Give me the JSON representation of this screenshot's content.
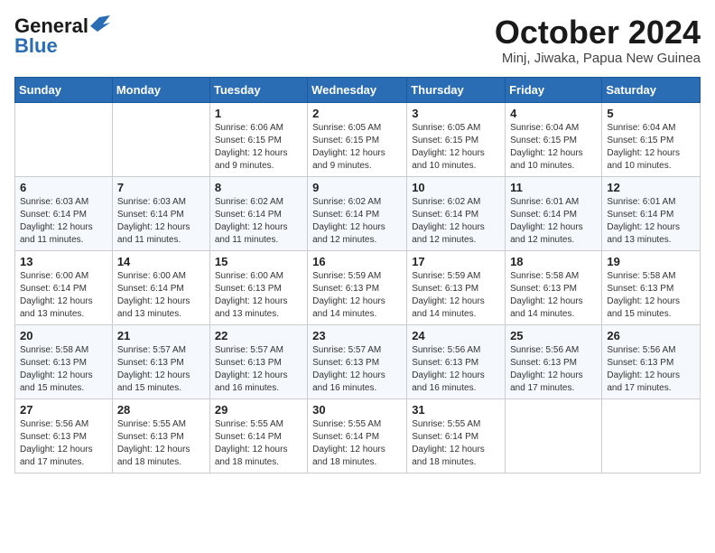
{
  "header": {
    "logo_general": "General",
    "logo_blue": "Blue",
    "month_title": "October 2024",
    "location": "Minj, Jiwaka, Papua New Guinea"
  },
  "days_of_week": [
    "Sunday",
    "Monday",
    "Tuesday",
    "Wednesday",
    "Thursday",
    "Friday",
    "Saturday"
  ],
  "weeks": [
    [
      {
        "day": "",
        "info": ""
      },
      {
        "day": "",
        "info": ""
      },
      {
        "day": "1",
        "info": "Sunrise: 6:06 AM\nSunset: 6:15 PM\nDaylight: 12 hours and 9 minutes."
      },
      {
        "day": "2",
        "info": "Sunrise: 6:05 AM\nSunset: 6:15 PM\nDaylight: 12 hours and 9 minutes."
      },
      {
        "day": "3",
        "info": "Sunrise: 6:05 AM\nSunset: 6:15 PM\nDaylight: 12 hours and 10 minutes."
      },
      {
        "day": "4",
        "info": "Sunrise: 6:04 AM\nSunset: 6:15 PM\nDaylight: 12 hours and 10 minutes."
      },
      {
        "day": "5",
        "info": "Sunrise: 6:04 AM\nSunset: 6:15 PM\nDaylight: 12 hours and 10 minutes."
      }
    ],
    [
      {
        "day": "6",
        "info": "Sunrise: 6:03 AM\nSunset: 6:14 PM\nDaylight: 12 hours and 11 minutes."
      },
      {
        "day": "7",
        "info": "Sunrise: 6:03 AM\nSunset: 6:14 PM\nDaylight: 12 hours and 11 minutes."
      },
      {
        "day": "8",
        "info": "Sunrise: 6:02 AM\nSunset: 6:14 PM\nDaylight: 12 hours and 11 minutes."
      },
      {
        "day": "9",
        "info": "Sunrise: 6:02 AM\nSunset: 6:14 PM\nDaylight: 12 hours and 12 minutes."
      },
      {
        "day": "10",
        "info": "Sunrise: 6:02 AM\nSunset: 6:14 PM\nDaylight: 12 hours and 12 minutes."
      },
      {
        "day": "11",
        "info": "Sunrise: 6:01 AM\nSunset: 6:14 PM\nDaylight: 12 hours and 12 minutes."
      },
      {
        "day": "12",
        "info": "Sunrise: 6:01 AM\nSunset: 6:14 PM\nDaylight: 12 hours and 13 minutes."
      }
    ],
    [
      {
        "day": "13",
        "info": "Sunrise: 6:00 AM\nSunset: 6:14 PM\nDaylight: 12 hours and 13 minutes."
      },
      {
        "day": "14",
        "info": "Sunrise: 6:00 AM\nSunset: 6:14 PM\nDaylight: 12 hours and 13 minutes."
      },
      {
        "day": "15",
        "info": "Sunrise: 6:00 AM\nSunset: 6:13 PM\nDaylight: 12 hours and 13 minutes."
      },
      {
        "day": "16",
        "info": "Sunrise: 5:59 AM\nSunset: 6:13 PM\nDaylight: 12 hours and 14 minutes."
      },
      {
        "day": "17",
        "info": "Sunrise: 5:59 AM\nSunset: 6:13 PM\nDaylight: 12 hours and 14 minutes."
      },
      {
        "day": "18",
        "info": "Sunrise: 5:58 AM\nSunset: 6:13 PM\nDaylight: 12 hours and 14 minutes."
      },
      {
        "day": "19",
        "info": "Sunrise: 5:58 AM\nSunset: 6:13 PM\nDaylight: 12 hours and 15 minutes."
      }
    ],
    [
      {
        "day": "20",
        "info": "Sunrise: 5:58 AM\nSunset: 6:13 PM\nDaylight: 12 hours and 15 minutes."
      },
      {
        "day": "21",
        "info": "Sunrise: 5:57 AM\nSunset: 6:13 PM\nDaylight: 12 hours and 15 minutes."
      },
      {
        "day": "22",
        "info": "Sunrise: 5:57 AM\nSunset: 6:13 PM\nDaylight: 12 hours and 16 minutes."
      },
      {
        "day": "23",
        "info": "Sunrise: 5:57 AM\nSunset: 6:13 PM\nDaylight: 12 hours and 16 minutes."
      },
      {
        "day": "24",
        "info": "Sunrise: 5:56 AM\nSunset: 6:13 PM\nDaylight: 12 hours and 16 minutes."
      },
      {
        "day": "25",
        "info": "Sunrise: 5:56 AM\nSunset: 6:13 PM\nDaylight: 12 hours and 17 minutes."
      },
      {
        "day": "26",
        "info": "Sunrise: 5:56 AM\nSunset: 6:13 PM\nDaylight: 12 hours and 17 minutes."
      }
    ],
    [
      {
        "day": "27",
        "info": "Sunrise: 5:56 AM\nSunset: 6:13 PM\nDaylight: 12 hours and 17 minutes."
      },
      {
        "day": "28",
        "info": "Sunrise: 5:55 AM\nSunset: 6:13 PM\nDaylight: 12 hours and 18 minutes."
      },
      {
        "day": "29",
        "info": "Sunrise: 5:55 AM\nSunset: 6:14 PM\nDaylight: 12 hours and 18 minutes."
      },
      {
        "day": "30",
        "info": "Sunrise: 5:55 AM\nSunset: 6:14 PM\nDaylight: 12 hours and 18 minutes."
      },
      {
        "day": "31",
        "info": "Sunrise: 5:55 AM\nSunset: 6:14 PM\nDaylight: 12 hours and 18 minutes."
      },
      {
        "day": "",
        "info": ""
      },
      {
        "day": "",
        "info": ""
      }
    ]
  ]
}
